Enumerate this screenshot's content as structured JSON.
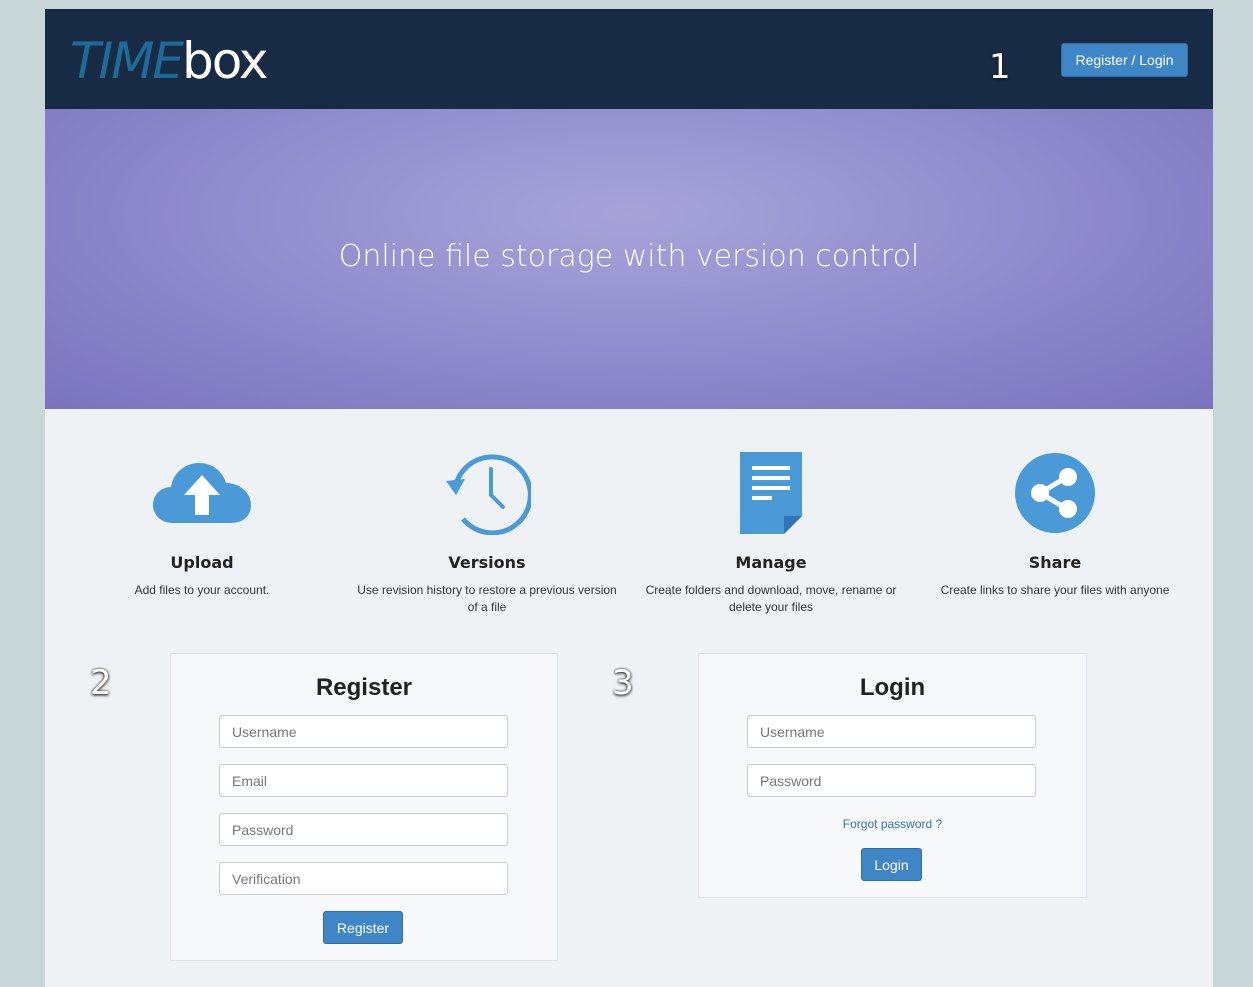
{
  "header": {
    "logo_time": "TIME",
    "logo_box": "box",
    "register_login_label": "Register / Login",
    "step_1": "1"
  },
  "hero": {
    "title": "Online file storage with version control"
  },
  "features": [
    {
      "icon": "cloud-upload-icon",
      "title": "Upload",
      "description": "Add files to your account."
    },
    {
      "icon": "clock-history-icon",
      "title": "Versions",
      "description": "Use revision history to restore a previous version of a file"
    },
    {
      "icon": "document-icon",
      "title": "Manage",
      "description": "Create folders and download, move, rename or delete your files"
    },
    {
      "icon": "share-icon",
      "title": "Share",
      "description": "Create links to share your files with anyone"
    }
  ],
  "register": {
    "step": "2",
    "title": "Register",
    "username_placeholder": "Username",
    "email_placeholder": "Email",
    "password_placeholder": "Password",
    "verification_placeholder": "Verification",
    "button_label": "Register"
  },
  "login": {
    "step": "3",
    "title": "Login",
    "username_placeholder": "Username",
    "password_placeholder": "Password",
    "forgot_label": "Forgot password ?",
    "button_label": "Login"
  },
  "colors": {
    "header_bg": "#172b44",
    "accent": "#3f86c6",
    "icon_blue": "#4a9ad8",
    "hero_purple": "#9793d1"
  }
}
